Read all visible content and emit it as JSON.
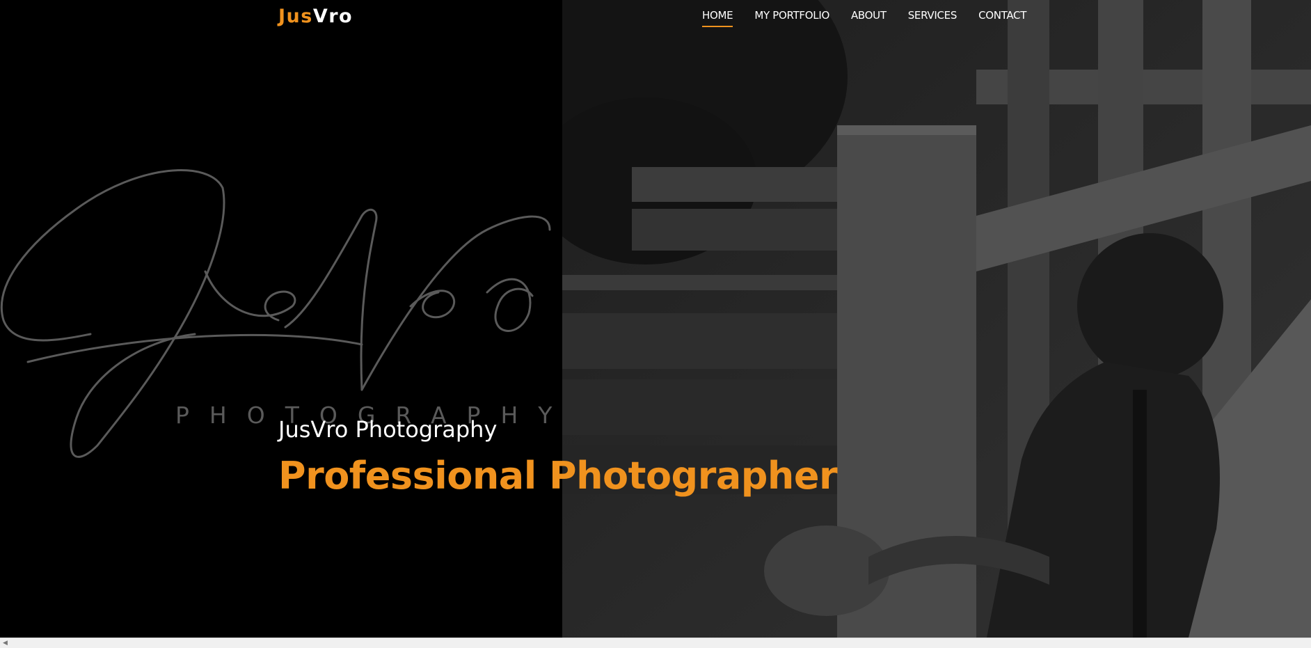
{
  "brand": {
    "part1": "Jus",
    "part2": "Vro"
  },
  "nav": {
    "home": "HOME",
    "portfolio": "MY PORTFOLIO",
    "about": "ABOUT",
    "services": "SERVICES",
    "contact": "CONTACT"
  },
  "logo": {
    "script": "JusVro",
    "sub": "PHOTOGRAPHY"
  },
  "hero": {
    "subtitle": "JusVro Photography",
    "headline": "Professional Photographer"
  },
  "colors": {
    "accent": "#f0921e",
    "background": "#000000",
    "text": "#ffffff"
  }
}
